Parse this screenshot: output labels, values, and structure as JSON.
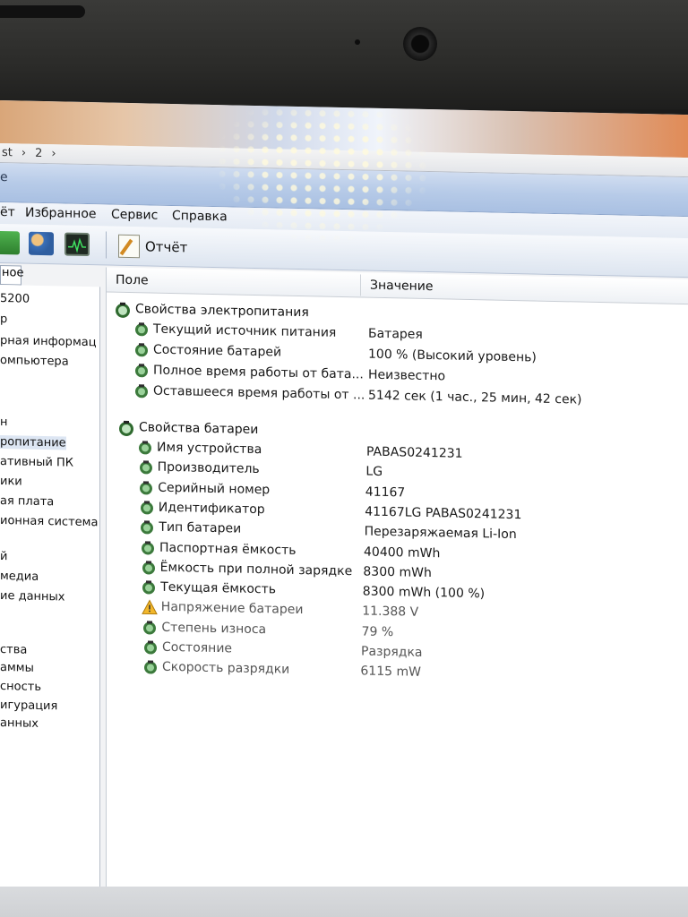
{
  "address": {
    "crumb1": "st",
    "sep1": "›",
    "crumb2": "2",
    "sep2": "›"
  },
  "window": {
    "title_fragment": "е"
  },
  "menu": {
    "items": [
      "ёт",
      "Избранное",
      "Сервис",
      "Справка"
    ]
  },
  "toolbar": {
    "report_label": "Отчёт"
  },
  "left_tab": {
    "label": "ное"
  },
  "tree": {
    "items": [
      "5200",
      "р",
      "рная информац",
      "омпьютера",
      "н",
      "ропитание",
      "ативный ПК",
      "ики",
      "ая плата",
      "ионная система",
      "й",
      "медиа",
      "ие данных",
      "ства",
      "аммы",
      "сность",
      "игурация",
      "анных"
    ],
    "selected_index": 5
  },
  "columns": {
    "field": "Поле",
    "value": "Значение"
  },
  "groups": [
    {
      "title": "Свойства электропитания",
      "rows": [
        {
          "field": "Текущий источник питания",
          "value": "Батарея",
          "icon": "battery-icon"
        },
        {
          "field": "Состояние батарей",
          "value": "100 % (Высокий уровень)",
          "icon": "battery-icon"
        },
        {
          "field": "Полное время работы от бата...",
          "value": "Неизвестно",
          "icon": "battery-icon"
        },
        {
          "field": "Оставшееся время работы от ...",
          "value": "5142 сек (1 час., 25 мин, 42 сек)",
          "icon": "battery-icon"
        }
      ]
    },
    {
      "title": "Свойства батареи",
      "rows": [
        {
          "field": "Имя устройства",
          "value": "PABAS0241231",
          "icon": "battery-icon"
        },
        {
          "field": "Производитель",
          "value": "LG",
          "icon": "battery-icon"
        },
        {
          "field": "Серийный номер",
          "value": "41167",
          "icon": "battery-icon"
        },
        {
          "field": "Идентификатор",
          "value": "41167LG PABAS0241231",
          "icon": "battery-icon"
        },
        {
          "field": "Тип батареи",
          "value": "Перезаряжаемая Li-Ion",
          "icon": "battery-icon"
        },
        {
          "field": "Паспортная ёмкость",
          "value": "40400 mWh",
          "icon": "battery-icon"
        },
        {
          "field": "Ёмкость при полной зарядке",
          "value": "8300 mWh",
          "icon": "battery-icon"
        },
        {
          "field": "Текущая ёмкость",
          "value": "8300 mWh  (100 %)",
          "icon": "battery-icon"
        },
        {
          "field": "Напряжение батареи",
          "value": "11.388 V",
          "icon": "warning-icon"
        },
        {
          "field": "Степень износа",
          "value": "79 %",
          "icon": "battery-icon"
        },
        {
          "field": "Состояние",
          "value": "Разрядка",
          "icon": "battery-icon"
        },
        {
          "field": "Скорость разрядки",
          "value": "6115 mW",
          "icon": "battery-icon"
        }
      ]
    }
  ]
}
